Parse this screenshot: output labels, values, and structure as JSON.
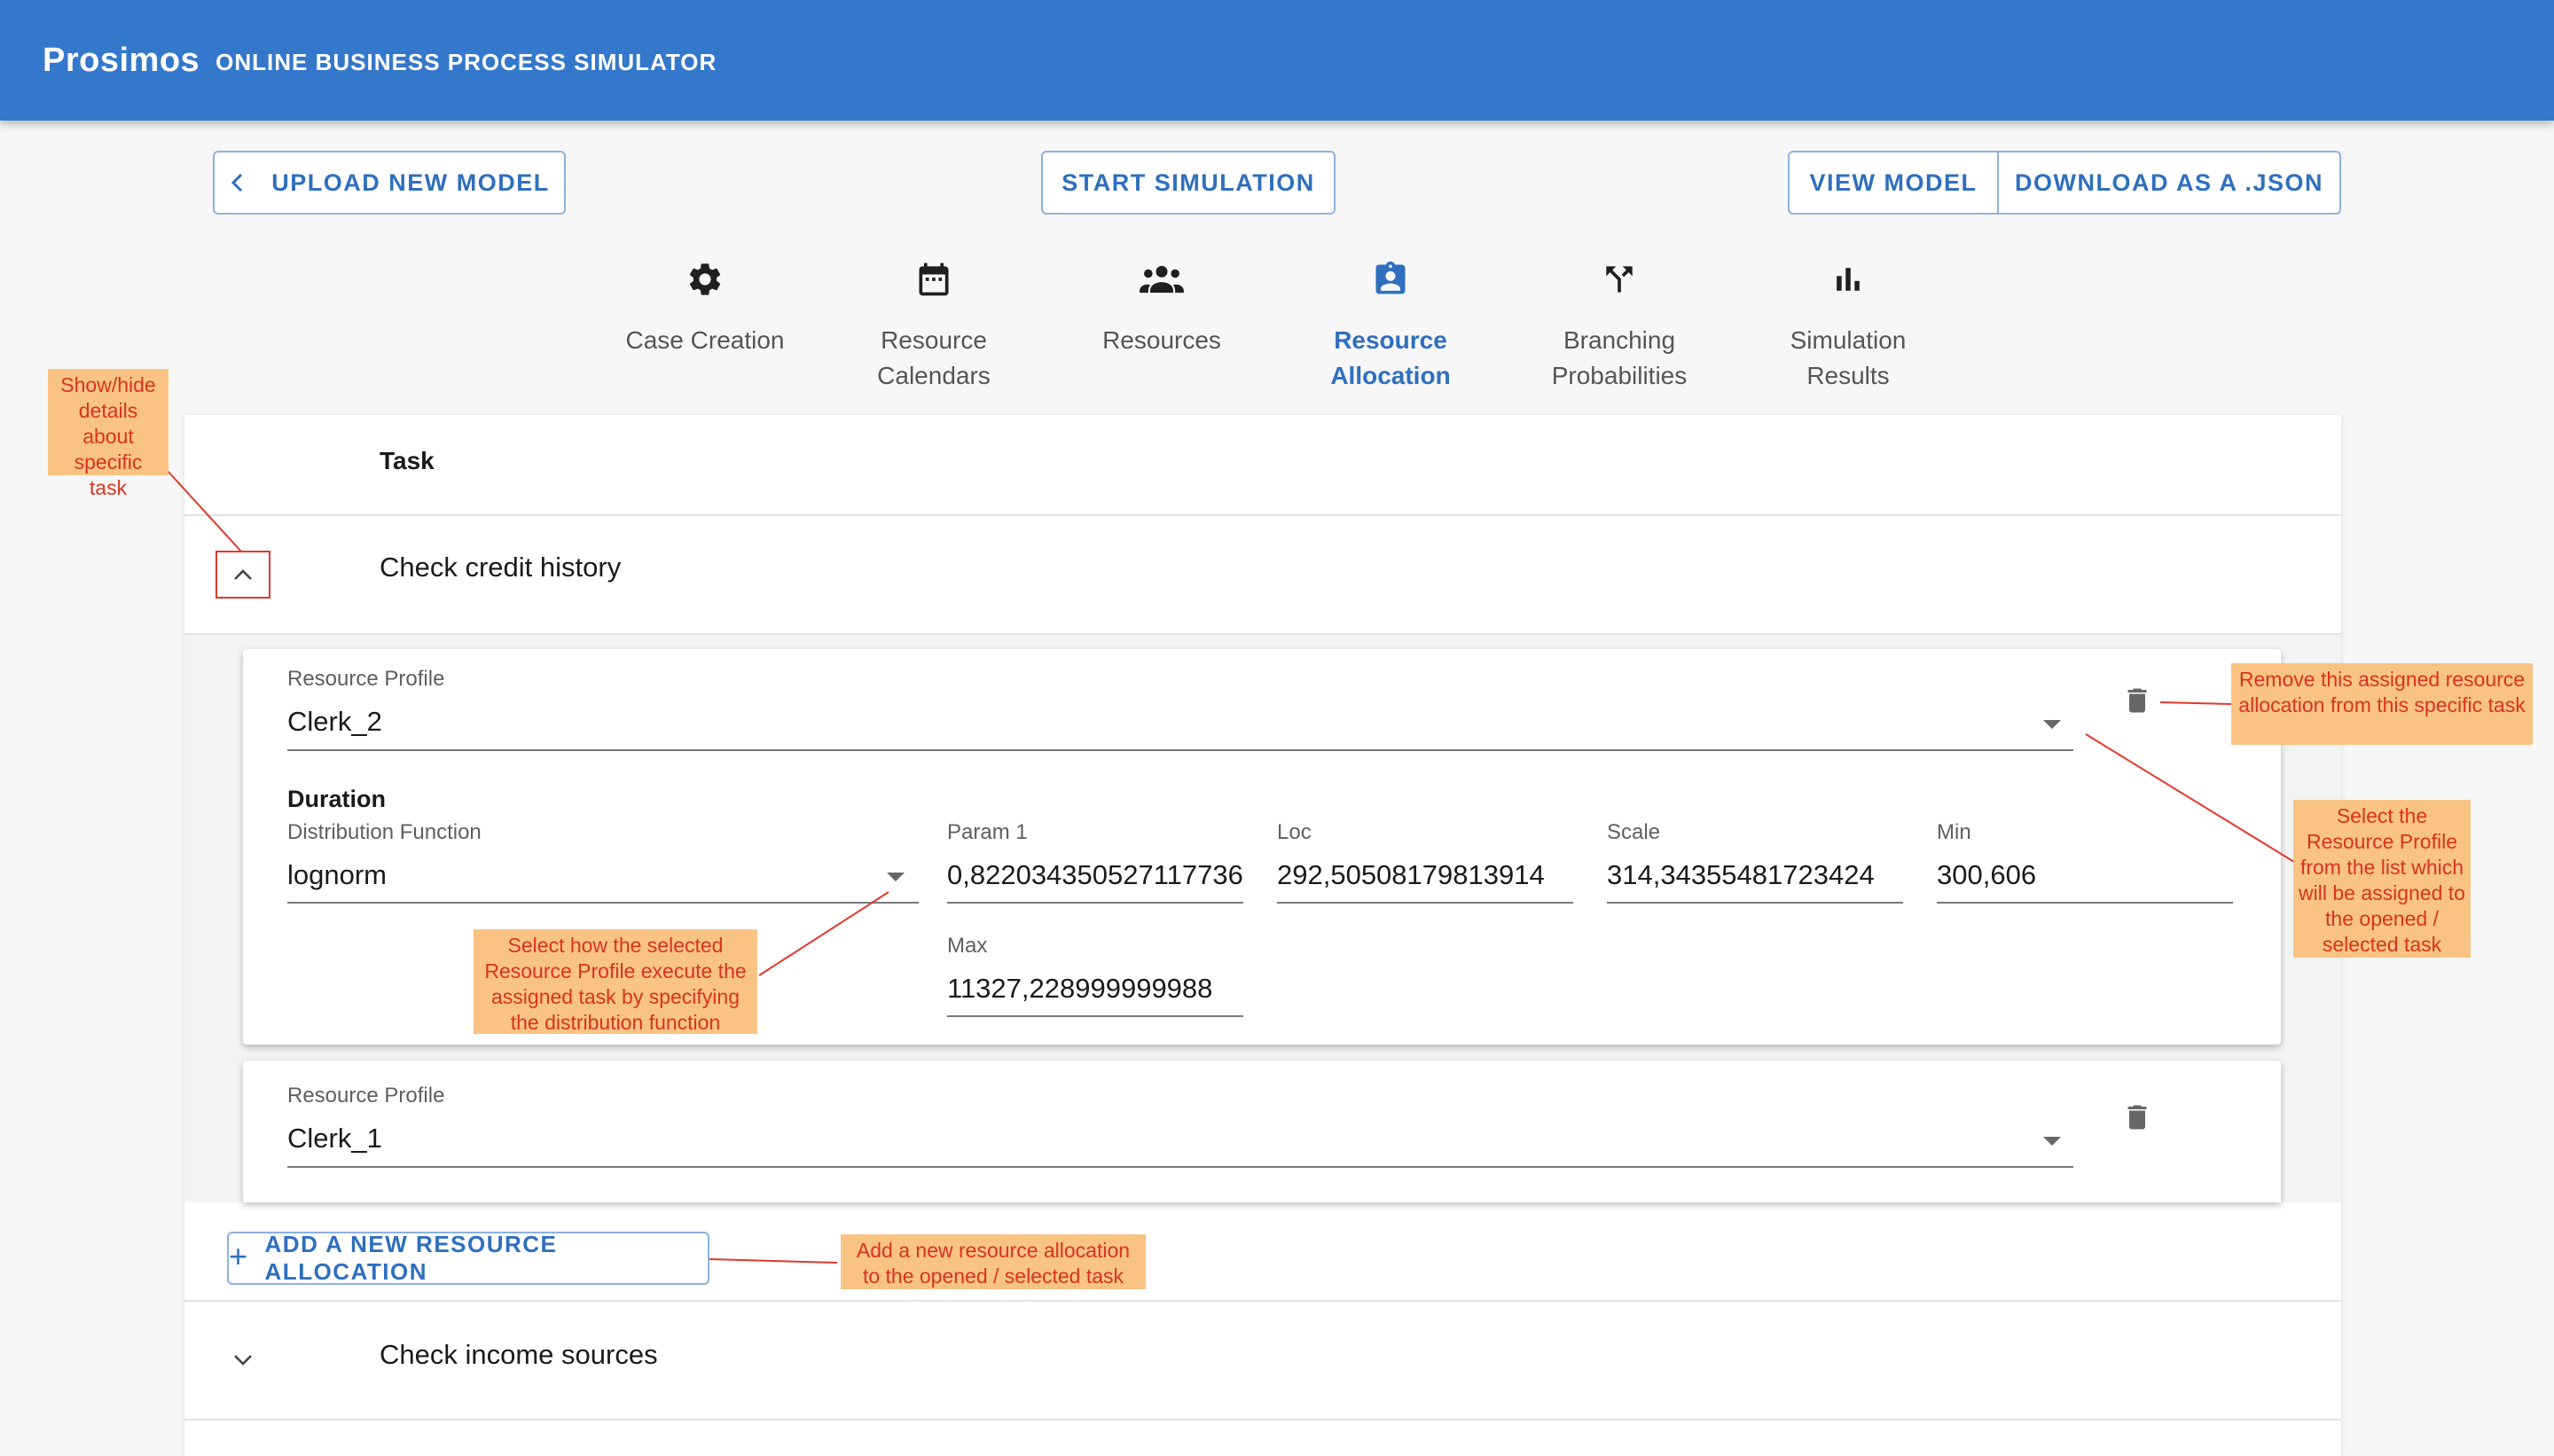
{
  "app": {
    "name": "Prosimos",
    "subtitle": "ONLINE BUSINESS PROCESS SIMULATOR"
  },
  "toolbar": {
    "upload_label": "UPLOAD NEW MODEL",
    "start_label": "START SIMULATION",
    "view_label": "VIEW MODEL",
    "download_label": "DOWNLOAD AS A .JSON"
  },
  "stepper": {
    "active": "Resource Allocation",
    "steps": [
      {
        "line1": "Case Creation",
        "line2": "",
        "icon": "gear-icon"
      },
      {
        "line1": "Resource",
        "line2": "Calendars",
        "icon": "calendar-icon"
      },
      {
        "line1": "Resources",
        "line2": "",
        "icon": "group-icon"
      },
      {
        "line1": "Resource",
        "line2": "Allocation",
        "icon": "assignment-ind-icon"
      },
      {
        "line1": "Branching",
        "line2": "Probabilities",
        "icon": "fork-arrows-icon"
      },
      {
        "line1": "Simulation",
        "line2": "Results",
        "icon": "bar-chart-icon"
      }
    ]
  },
  "table": {
    "header": "Task",
    "tasks": [
      {
        "name": "Check credit history",
        "expanded": true,
        "allocations": [
          {
            "resource_profile_label": "Resource Profile",
            "resource_profile": "Clerk_2",
            "duration_label": "Duration",
            "distribution_label": "Distribution Function",
            "distribution": "lognorm",
            "params": [
              {
                "label": "Param 1",
                "value": "0,822034350527117736"
              },
              {
                "label": "Loc",
                "value": "292,50508179813914"
              },
              {
                "label": "Scale",
                "value": "314,34355481723424"
              },
              {
                "label": "Min",
                "value": "300,606"
              },
              {
                "label": "Max",
                "value": "11327,228999999988"
              }
            ]
          },
          {
            "resource_profile_label": "Resource Profile",
            "resource_profile": "Clerk_1"
          }
        ],
        "add_label": "ADD A NEW RESOURCE ALLOCATION"
      },
      {
        "name": "Check income sources",
        "expanded": false
      }
    ]
  },
  "annotations": {
    "toggle": "Show/hide details about specific task",
    "remove": "Remove this assigned resource allocation from this specific task",
    "select_profile": "Select the Resource Profile from the list which will be assigned to the opened / selected task",
    "distribution": "Select how the selected Resource Profile execute the assigned task by specifying the distribution function",
    "add": "Add a new resource allocation to the opened / selected task"
  },
  "colors": {
    "appbar": "#3478cb",
    "accent": "#2f6fbe",
    "annotation_bg": "#f9c384",
    "annotation_text": "#d9331f"
  }
}
